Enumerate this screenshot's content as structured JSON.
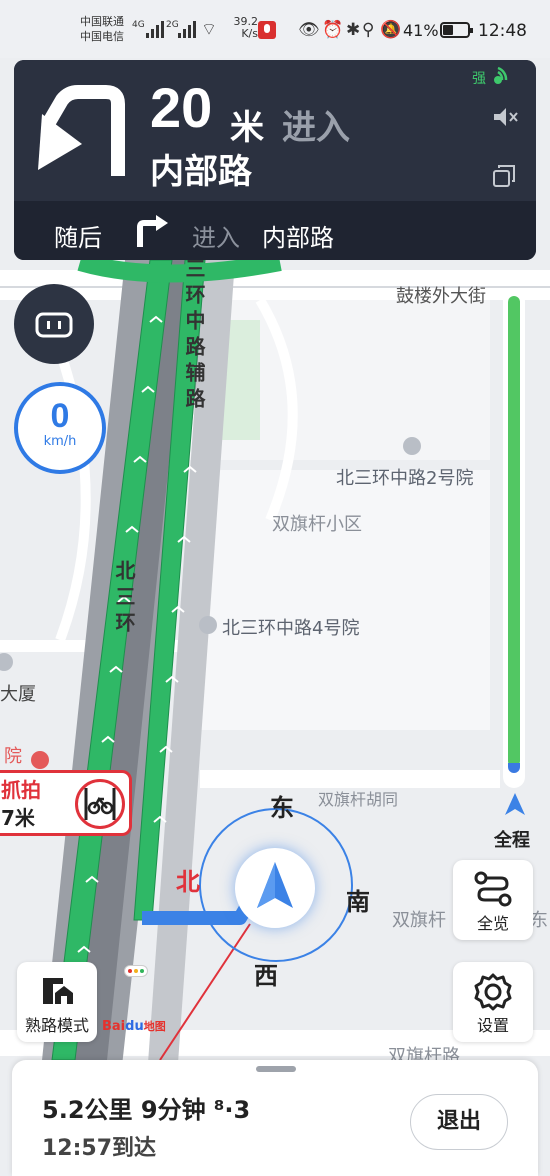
{
  "status_bar": {
    "carrier_1": "中国联通",
    "carrier_2": "中国电信",
    "net_type_1": "4G",
    "net_type_2": "2G",
    "net_speed_value": "39.2",
    "net_speed_unit": "K/s",
    "battery_percent": "41%",
    "time": "12:48"
  },
  "nav": {
    "distance": "20",
    "distance_unit": "米",
    "action": "进入",
    "road_name": "内部路",
    "signal_label": "强",
    "then_label": "随后",
    "then_action": "进入",
    "then_road": "内部路"
  },
  "speed": {
    "value": "0",
    "unit": "km/h"
  },
  "route_progress": {
    "remaining_fraction": 0.97
  },
  "map_labels": {
    "gulou": "鼓楼外大街",
    "bei3_2": "北三环中路2号院",
    "shuangqi_xiaoqu": "双旗杆小区",
    "bei3_4": "北三环中路4号院",
    "shuangqi_hutong": "双旗杆胡同",
    "shuangqi_right": "双旗杆",
    "shuangqi_right_tail": "东",
    "building": "大厦",
    "hospital": "院",
    "fulu": "三环中路辅路",
    "bei3huan": "北三环",
    "bottom_road": "双旗杆路"
  },
  "compass": {
    "north": "北",
    "east": "东",
    "south": "南",
    "west": "西"
  },
  "camera": {
    "label": "抓拍",
    "distance": "7米"
  },
  "buttons": {
    "whole_route": "全程",
    "overview": "全览",
    "settings": "设置",
    "familiar_mode": "熟路模式",
    "exit": "退出"
  },
  "brand": {
    "bai": "Bai",
    "du": "du",
    "map": "地图"
  },
  "trip": {
    "summary": "5.2公里 9分钟 ⁸·3",
    "eta": "12:57到达"
  },
  "colors": {
    "route_green": "#2fb866",
    "route_blue": "#3b82e6",
    "nav_bg": "#2b3140",
    "camera_red": "#e0323b"
  }
}
